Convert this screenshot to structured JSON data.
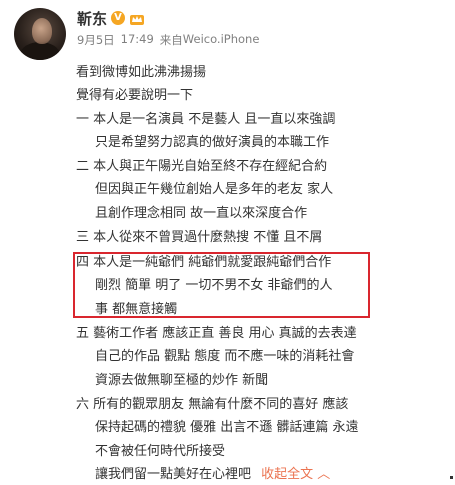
{
  "user": {
    "name": "靳东",
    "verified_badge": "V",
    "verified_badge_icon": "verified-v-icon",
    "crown_badge_icon": "vip-crown-icon",
    "avatar_icon": "user-avatar"
  },
  "meta": {
    "date": "9月5日",
    "time": "17:49",
    "source_prefix": "来自",
    "source": "Weico.iPhone"
  },
  "lines": [
    "看到微博如此沸沸揚揚",
    "覺得有必要說明一下",
    "一 本人是一名演員 不是藝人 且一直以來強調",
    "只是希望努力認真的做好演員的本職工作",
    "二 本人與正午陽光自始至終不存在經紀合約",
    "但因與正午幾位創始人是多年的老友 家人",
    "且創作理念相同 故一直以來深度合作",
    "三 本人從來不曾買過什麼熱搜 不懂 且不屑",
    "四 本人是一純爺們 純爺們就愛跟純爺們合作",
    "剛烈 簡單 明了 一切不男不女 非爺們的人",
    "事 都無意接觸",
    "五 藝術工作者 應該正直 善良 用心 真誠的去表達",
    "自己的作品 觀點 態度 而不應一味的消耗社會",
    "資源去做無聊至極的炒作 新聞",
    "六 所有的觀眾朋友 無論有什麼不同的喜好 應該",
    "保持起碼的禮貌 優雅 出言不遜 髒話連篇 永遠",
    "不會被任何時代所接受",
    "讓我們留一點美好在心裡吧"
  ],
  "collapse_link": "收起全文 ︿",
  "colors": {
    "text": "#333333",
    "meta": "#808080",
    "link": "#eb7350",
    "highlight": "#d9262e"
  }
}
